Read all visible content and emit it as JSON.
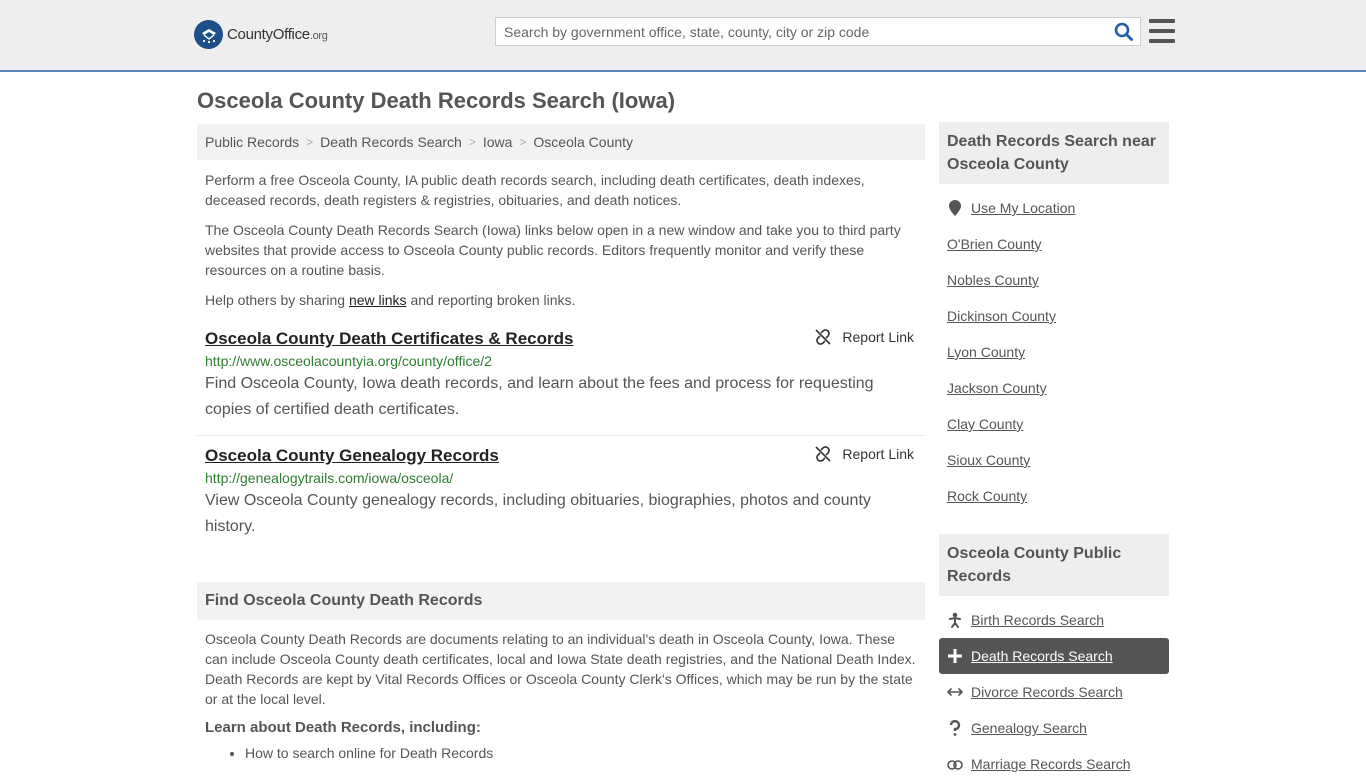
{
  "header": {
    "logo_main": "CountyOffice",
    "logo_suffix": ".org",
    "search_placeholder": "Search by government office, state, county, city or zip code"
  },
  "page_title": "Osceola County Death Records Search (Iowa)",
  "breadcrumb": [
    "Public Records",
    "Death Records Search",
    "Iowa",
    "Osceola County"
  ],
  "breadcrumb_sep": ">",
  "intro": {
    "p1": "Perform a free Osceola County, IA public death records search, including death certificates, death indexes, deceased records, death registers & registries, obituaries, and death notices.",
    "p2": "The Osceola County Death Records Search (Iowa) links below open in a new window and take you to third party websites that provide access to Osceola County public records. Editors frequently monitor and verify these resources on a routine basis.",
    "p3_before": "Help others by sharing ",
    "p3_link": "new links",
    "p3_after": " and reporting broken links."
  },
  "results": [
    {
      "title": "Osceola County Death Certificates & Records",
      "url": "http://www.osceolacountyia.org/county/office/2",
      "desc": "Find Osceola County, Iowa death records, and learn about the fees and process for requesting copies of certified death certificates.",
      "report": "Report Link"
    },
    {
      "title": "Osceola County Genealogy Records",
      "url": "http://genealogytrails.com/iowa/osceola/",
      "desc": "View Osceola County genealogy records, including obituaries, biographies, photos and county history.",
      "report": "Report Link"
    }
  ],
  "find_section": {
    "heading": "Find Osceola County Death Records",
    "text": "Osceola County Death Records are documents relating to an individual's death in Osceola County, Iowa. These can include Osceola County death certificates, local and Iowa State death registries, and the National Death Index. Death Records are kept by Vital Records Offices or Osceola County Clerk's Offices, which may be run by the state or at the local level.",
    "learn_heading": "Learn about Death Records, including:",
    "learn_items": [
      "How to search online for Death Records"
    ]
  },
  "sidebar": {
    "near_heading": "Death Records Search near Osceola County",
    "near_items": [
      "Use My Location",
      "O'Brien County",
      "Nobles County",
      "Dickinson County",
      "Lyon County",
      "Jackson County",
      "Clay County",
      "Sioux County",
      "Rock County"
    ],
    "public_heading": "Osceola County Public Records",
    "public_items": [
      "Birth Records Search",
      "Death Records Search",
      "Divorce Records Search",
      "Genealogy Search",
      "Marriage Records Search"
    ],
    "public_icons": [
      "baby-icon",
      "cross-icon",
      "arrows-icon",
      "question-icon",
      "rings-icon"
    ],
    "active_item": "Death Records Search"
  },
  "colors": {
    "header_bg": "#eeeeee",
    "header_border": "#5b87b7",
    "logo_blue": "#1e4f88",
    "url_green": "#2f7d32",
    "active_bg": "#555555"
  }
}
